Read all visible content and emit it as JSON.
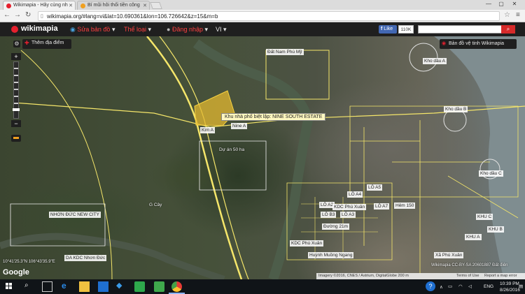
{
  "browser": {
    "tabs": [
      {
        "title": "Wikimapia - Hãy cùng nh",
        "active": true
      },
      {
        "title": "Bí mũi hôi thối tiền công",
        "active": false
      }
    ],
    "url": "wikimapia.org/#lang=vi&lat=10.690361&lon=106.726642&z=15&m=b"
  },
  "header": {
    "logo": "wikimapia",
    "menu": {
      "edit_map": "Sửa bản đồ",
      "categories": "Thể loại",
      "login": "Đăng nhập",
      "language": "VI"
    },
    "fb_like": "Like",
    "fb_count": "110K"
  },
  "map": {
    "add_place": "Thêm địa điểm",
    "satellite_label": "Bản đồ vệ tinh Wikimapia",
    "tooltip": "Khu nhà phố biệt lập: NINE SOUTH ESTATE",
    "labels": {
      "dai_nam_phu_my": "Đất Nam Phú Mỹ",
      "kho_dau_a": "Kho dầu A",
      "kho_dau_b": "Kho dầu B",
      "kho_dau_c": "Kho dầu C",
      "kim_a": "Kim A",
      "nine_a": "Nine A",
      "du_an": "Dự án 50 ha",
      "g_cay": "G Cây",
      "nhon_duc": "NHƠN ĐỨC NEW CITY",
      "da_kdc": "DA KDC Nhơn Đức",
      "lo_a5": "LÔ A5",
      "lo_a4": "LÔ A4",
      "lo_a2": "LÔ A2",
      "lo_a3": "LÔ A3",
      "lo_a7": "LÔ A7",
      "kdc_phu_xuan": "KDC Phú Xuân",
      "kdc_phu_xuan_2": "KDC Phú Xuân",
      "lo_a1": "LÔ A1",
      "lo_b3": "LÔ B3",
      "hem_150": "Hẻm 150",
      "duong_21": "Đường 21m",
      "huynh_muong": "Huỳnh Muồng Ngang",
      "xa_phu_xuan": "Xã Phú Xuân",
      "khu_c": "KHU C",
      "khu_b": "KHU B",
      "khu_a": "KHU A"
    },
    "coords": "10°41'25.3\"N 106°43'35.9\"E",
    "google": "Google",
    "copyright": "Imagery ©2016, CNES / Astrium, DigitalGlobe  200 m",
    "wikimapia_cc": "Wikimapia CC-BY-SA 20601887 Đất điên",
    "terms": "Terms of Use",
    "report": "Report a map error"
  },
  "taskbar": {
    "time": "10:39 PM",
    "date": "8/26/2016",
    "lang": "ENG"
  },
  "colors": {
    "road": "#f5e66a",
    "highlight": "#e3b830",
    "wm_red": "#e5202e"
  }
}
